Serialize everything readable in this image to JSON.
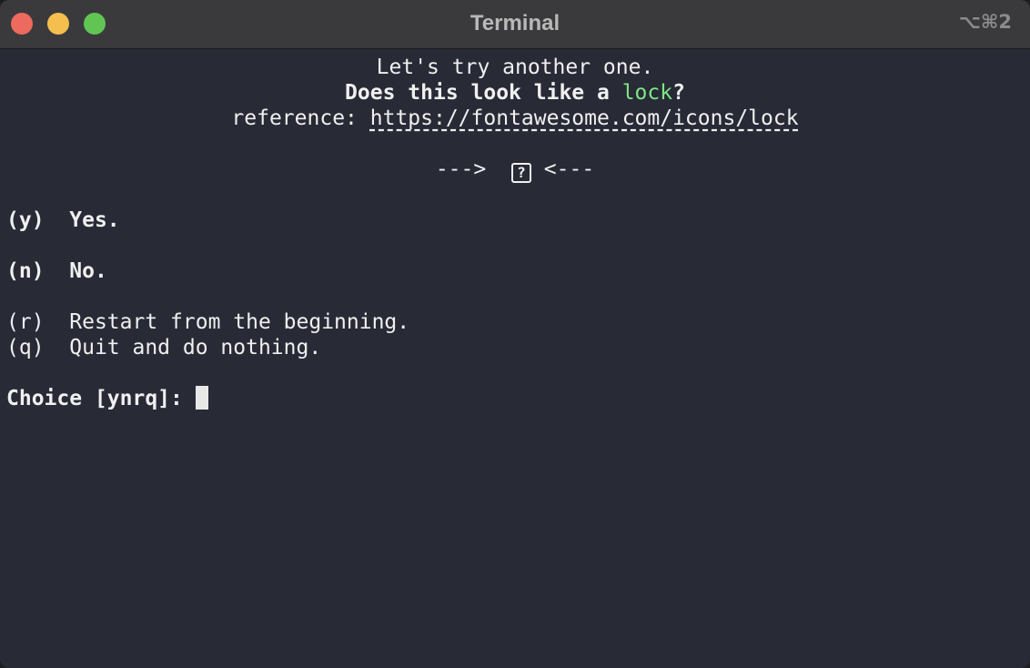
{
  "window": {
    "title": "Terminal",
    "shortcut": "⌥⌘2"
  },
  "terminal": {
    "intro": "Let's try another one.",
    "question_prefix": "Does this look like a ",
    "question_icon_name": "lock",
    "question_suffix": "?",
    "reference_label": "reference: ",
    "reference_url": "https://fontawesome.com/icons/lock",
    "arrow_left": "--->",
    "icon_glyph": "?",
    "arrow_right": "<---",
    "options": [
      {
        "key": "(y)",
        "text": "Yes."
      },
      {
        "key": "(n)",
        "text": "No."
      },
      {
        "key": "(r)",
        "text": "Restart from the beginning."
      },
      {
        "key": "(q)",
        "text": "Quit and do nothing."
      }
    ],
    "prompt": "Choice [ynrq]: "
  },
  "colors": {
    "background": "#282a36",
    "text": "#f0f0f0",
    "accent_green": "#7ee787",
    "titlebar": "#3a3a3c"
  }
}
